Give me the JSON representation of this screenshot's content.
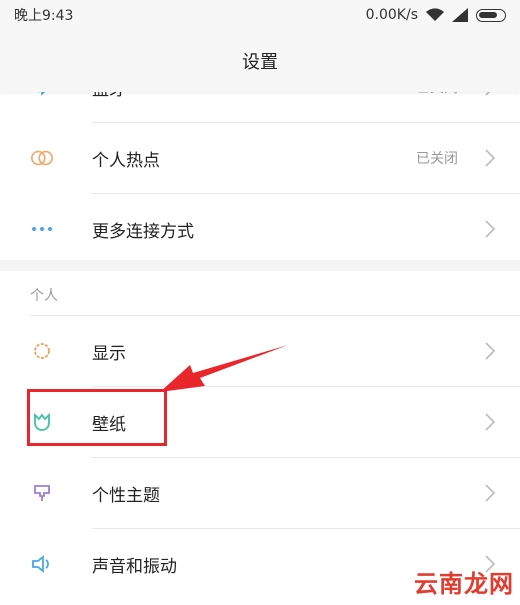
{
  "status": {
    "time": "晚上9:43",
    "speed": "0.00K/s"
  },
  "titlebar": {
    "title": "设置"
  },
  "top_section": {
    "rows": [
      {
        "label": "蓝牙",
        "value": "已关闭"
      },
      {
        "label": "个人热点",
        "value": "已关闭"
      },
      {
        "label": "更多连接方式",
        "value": ""
      }
    ]
  },
  "personal": {
    "header": "个人",
    "rows": [
      {
        "label": "显示"
      },
      {
        "label": "壁纸"
      },
      {
        "label": "个性主题"
      },
      {
        "label": "声音和振动"
      }
    ]
  },
  "watermark": {
    "text": "云南龙网"
  },
  "colors": {
    "annotation": "#e8262b",
    "hotspot_icon": "#f0a86c",
    "more_icon": "#4aa6e6",
    "display_icon": "#f0a050",
    "wallpaper_icon": "#3ec2a0",
    "theme_icon": "#9b7fd6",
    "sound_icon": "#4aa6e6"
  },
  "icons": {
    "bluetooth": "bluetooth-icon",
    "hotspot": "hotspot-icon",
    "more": "more-dots-icon",
    "display": "sun-icon",
    "wallpaper": "tulip-icon",
    "theme": "brush-icon",
    "sound": "speaker-icon"
  }
}
